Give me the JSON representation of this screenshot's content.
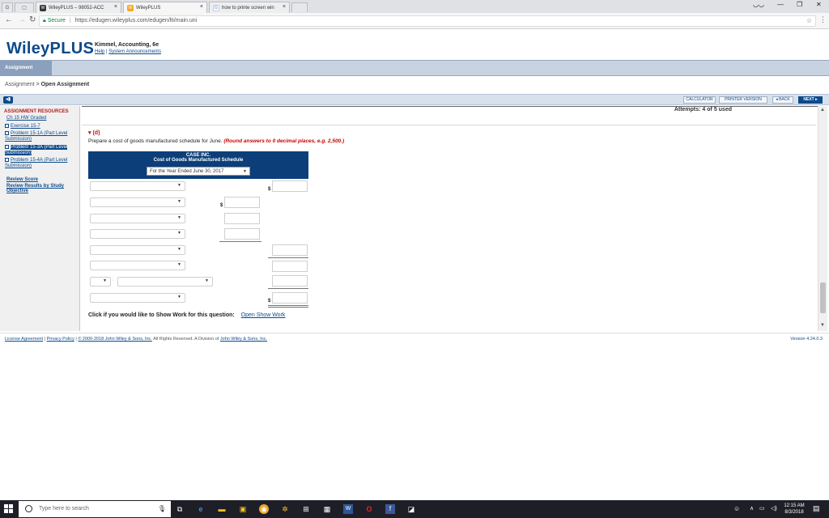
{
  "browser": {
    "tabs": [
      {
        "title": "WileyPLUS – 98052-ACC"
      },
      {
        "title": "WileyPLUS"
      },
      {
        "title": "how to printe screen win"
      }
    ],
    "url": {
      "secure_label": "Secure",
      "address": "https://edugen.wileyplus.com/edugen/lti/main.uni"
    }
  },
  "header": {
    "brand": "WileyPLUS",
    "course_title": "Kimmel, Accounting, 6e",
    "help_link": "Help",
    "announcements_link": "System Announcements"
  },
  "nav": {
    "active_tab": "Assignment"
  },
  "breadcrumb": {
    "parent": "Assignment",
    "separator": ">",
    "current": "Open Assignment"
  },
  "toolbar": {
    "calculator": "CALCULATOR",
    "printer": "PRINTER VERSION",
    "back": "◂ BACK",
    "next": "NEXT ▸"
  },
  "sidebar": {
    "title": "ASSIGNMENT RESOURCES",
    "chapter_link": "Ch 15 HW Graded",
    "items": [
      {
        "label": "Exercise 15-7",
        "selected": false
      },
      {
        "label": "Problem 15-1A (Part Level Submission)",
        "selected": false
      },
      {
        "label": "Problem 15-3A (Part Level Submission)",
        "selected": true
      },
      {
        "label": "Problem 15-4A (Part Level Submission)",
        "selected": false
      }
    ],
    "review_score": "Review Score",
    "review_results": "Review Results by Study Objective"
  },
  "question": {
    "attempts": "Attempts: 4 of 5 used",
    "part_label": "(d)",
    "prompt": "Prepare a cost of goods manufactured schedule for June.",
    "round_note": "(Round answers to 0 decimal places, e.g. 2,500.)",
    "company": "CASE INC.",
    "schedule_title": "Cost of Goods Manufactured Schedule",
    "period": "For the Year Ended June 30, 2017",
    "dollar_sign": "$",
    "show_work_prompt": "Click if you would like to Show Work for this question:",
    "show_work_link": "Open Show Work"
  },
  "footer": {
    "license": "License Agreement",
    "privacy": "Privacy Policy",
    "copyright": "© 2000-2018 John Wiley & Sons, Inc.",
    "rights": "All Rights Reserved. A Division of",
    "company_link": "John Wiley & Sons, Inc.",
    "version": "Version 4.24.0.3"
  },
  "taskbar": {
    "search_placeholder": "Type here to search",
    "time": "12:15 AM",
    "date": "8/3/2018"
  }
}
